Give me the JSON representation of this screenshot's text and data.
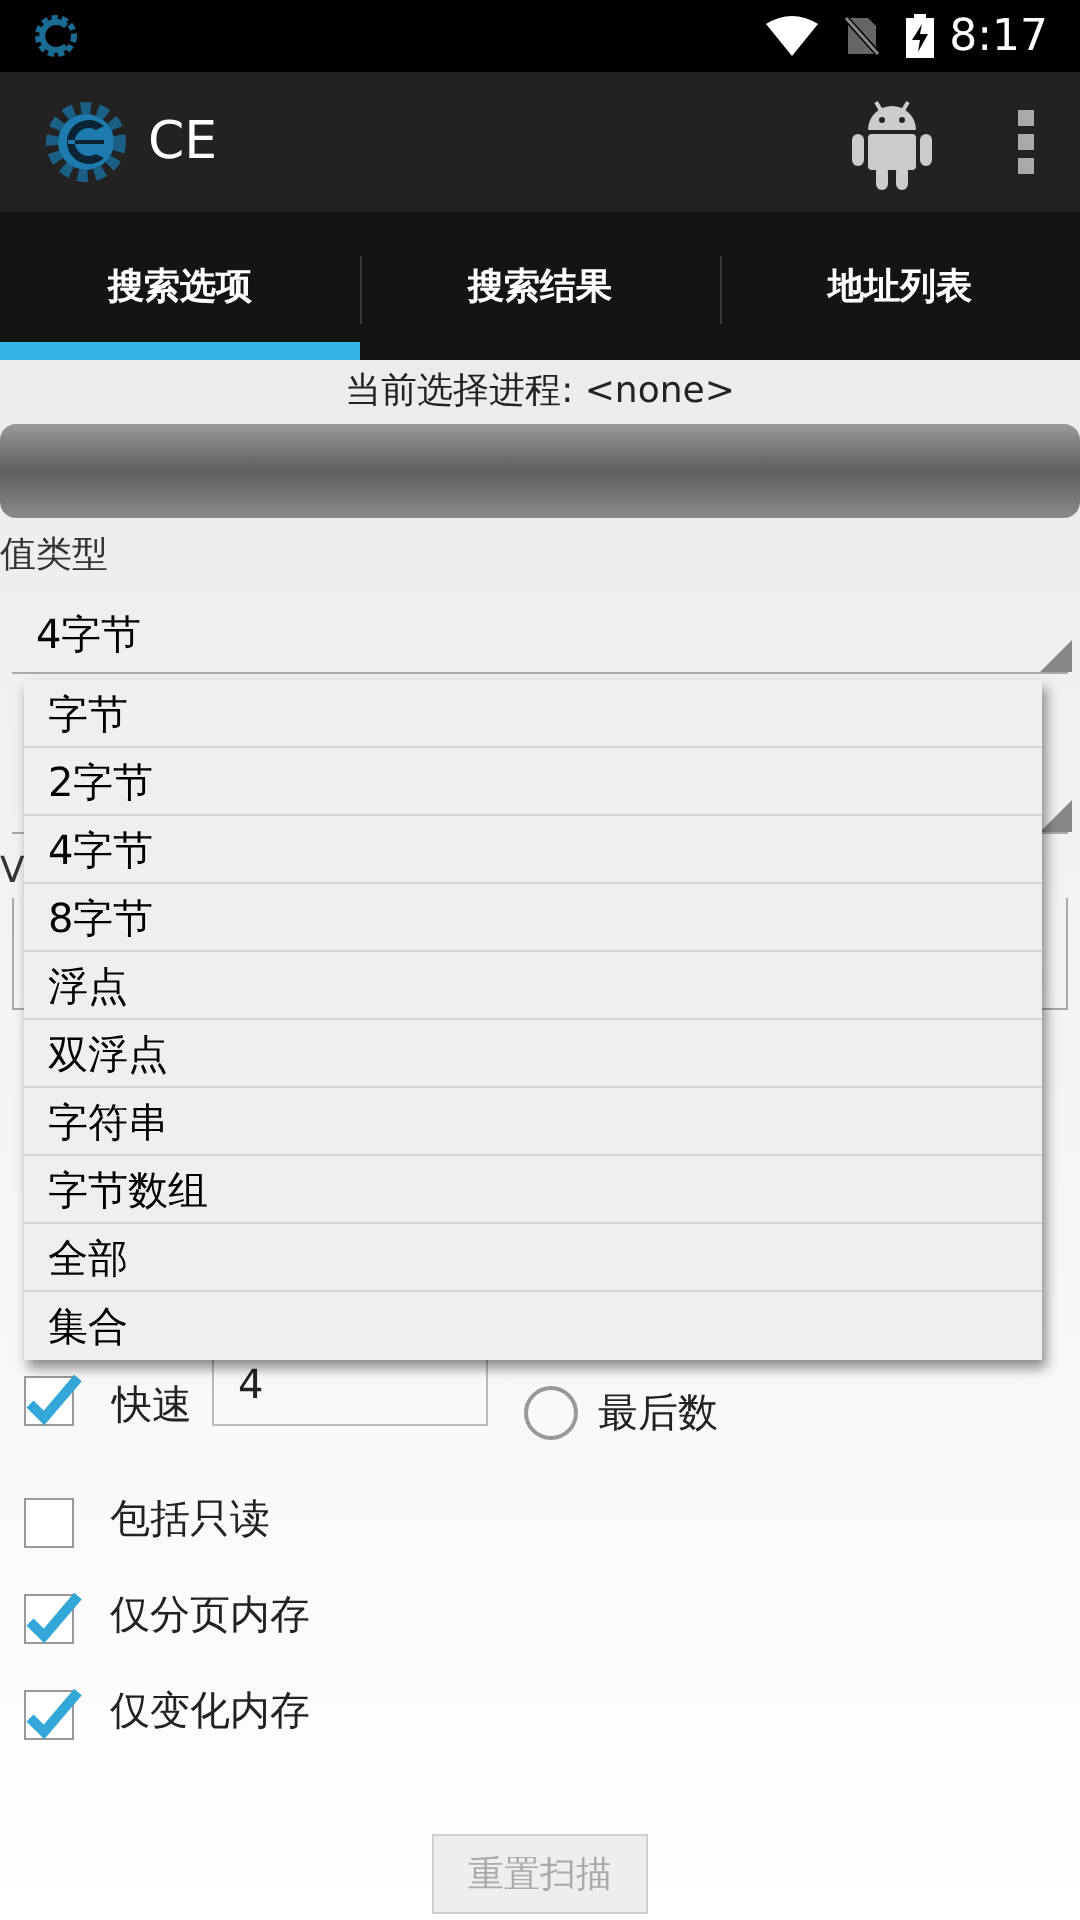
{
  "status_bar": {
    "time": "8:17"
  },
  "app_bar": {
    "title": "CE"
  },
  "tabs": [
    {
      "label": "搜索选项",
      "selected": true
    },
    {
      "label": "搜索结果",
      "selected": false
    },
    {
      "label": "地址列表",
      "selected": false
    }
  ],
  "process_label": "当前选择进程: <none>",
  "value_type": {
    "label": "值类型",
    "value": "4字节"
  },
  "value_label": "V",
  "dropdown": {
    "options": [
      {
        "label": "字节"
      },
      {
        "label": "2字节"
      },
      {
        "label": "4字节"
      },
      {
        "label": "8字节"
      },
      {
        "label": "浮点"
      },
      {
        "label": "双浮点"
      },
      {
        "label": "字符串"
      },
      {
        "label": "字节数组"
      },
      {
        "label": "全部"
      },
      {
        "label": "集合"
      }
    ]
  },
  "fast_scan": {
    "label": "快速",
    "checked": true,
    "value": "4"
  },
  "last_digits": {
    "label": "最后数",
    "selected": false
  },
  "checkboxes": [
    {
      "label": "包括只读",
      "checked": false
    },
    {
      "label": "仅分页内存",
      "checked": true
    },
    {
      "label": "仅变化内存",
      "checked": true
    }
  ],
  "reset_button": {
    "label": "重置扫描",
    "disabled": true
  }
}
